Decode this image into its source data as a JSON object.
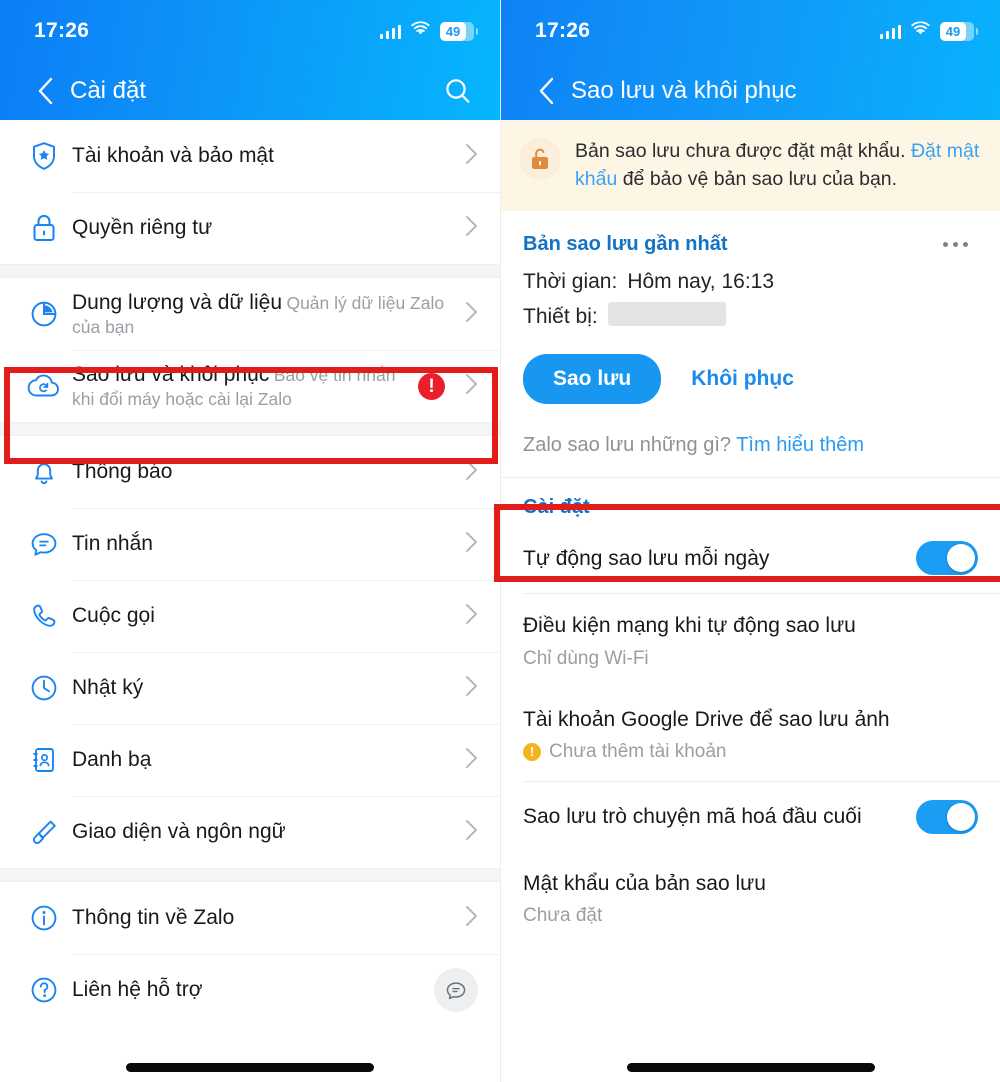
{
  "status_bar": {
    "time": "17:26",
    "battery": "49",
    "signal_icon": "cellular-signal-icon",
    "wifi_icon": "wifi-icon",
    "battery_icon": "battery-icon"
  },
  "left_panel": {
    "nav": {
      "back_icon": "chevron-left-icon",
      "title": "Cài đặt",
      "search_icon": "search-icon"
    },
    "groups": [
      {
        "items": [
          {
            "icon": "shield-star-icon",
            "title": "Tài khoản và bảo mật",
            "sub": "",
            "chevron": "chevron-right-icon"
          },
          {
            "icon": "lock-icon",
            "title": "Quyền riêng tư",
            "sub": "",
            "chevron": "chevron-right-icon"
          }
        ]
      },
      {
        "items": [
          {
            "icon": "pie-chart-icon",
            "title": "Dung lượng và dữ liệu",
            "sub": "Quản lý dữ liệu Zalo của bạn",
            "chevron": "chevron-right-icon"
          },
          {
            "icon": "cloud-backup-icon",
            "title": "Sao lưu và khôi phục",
            "sub": "Bảo vệ tin nhắn khi đổi máy hoặc cài lại Zalo",
            "alert": "!",
            "chevron": "chevron-right-icon"
          }
        ]
      },
      {
        "items": [
          {
            "icon": "bell-icon",
            "title": "Thông báo",
            "sub": "",
            "chevron": "chevron-right-icon"
          },
          {
            "icon": "message-icon",
            "title": "Tin nhắn",
            "sub": "",
            "chevron": "chevron-right-icon"
          },
          {
            "icon": "phone-icon",
            "title": "Cuộc gọi",
            "sub": "",
            "chevron": "chevron-right-icon"
          },
          {
            "icon": "clock-icon",
            "title": "Nhật ký",
            "sub": "",
            "chevron": "chevron-right-icon"
          },
          {
            "icon": "contacts-book-icon",
            "title": "Danh bạ",
            "sub": "",
            "chevron": "chevron-right-icon"
          },
          {
            "icon": "paint-brush-icon",
            "title": "Giao diện và ngôn ngữ",
            "sub": "",
            "chevron": "chevron-right-icon"
          }
        ]
      },
      {
        "items": [
          {
            "icon": "info-circle-icon",
            "title": "Thông tin về Zalo",
            "sub": "",
            "chevron": "chevron-right-icon"
          },
          {
            "icon": "question-circle-icon",
            "title": "Liên hệ hỗ trợ",
            "sub": "",
            "fab": "chat-bubble-icon"
          }
        ]
      }
    ]
  },
  "right_panel": {
    "nav": {
      "back_icon": "chevron-left-icon",
      "title": "Sao lưu và khôi phục"
    },
    "banner": {
      "icon": "unlock-icon",
      "text_before": "Bản sao lưu chưa được đặt mật khẩu. ",
      "link": "Đặt mật khẩu",
      "text_after": " để bảo vệ bản sao lưu của bạn."
    },
    "latest_backup": {
      "section_title": "Bản sao lưu gần nhất",
      "more_icon": "more-horizontal-icon",
      "time_label": "Thời gian:",
      "time_value": "Hôm nay, 16:13",
      "device_label": "Thiết bị:",
      "device_value": ""
    },
    "actions": {
      "backup_button": "Sao lưu",
      "restore_link": "Khôi phục"
    },
    "hint": {
      "text": "Zalo sao lưu những gì? ",
      "link": "Tìm hiểu thêm"
    },
    "settings": {
      "group_title": "Cài đặt",
      "options": [
        {
          "name": "Tự động sao lưu mỗi ngày",
          "value": "",
          "control": "toggle",
          "toggle_on": true
        },
        {
          "name": "Điều kiện mạng khi tự động sao lưu",
          "value": "Chỉ dùng Wi-Fi",
          "control": "none"
        },
        {
          "name": "Tài khoản Google Drive để sao lưu ảnh",
          "value": "Chưa thêm tài khoản",
          "control": "none",
          "warn": "!"
        },
        {
          "name": "Sao lưu trò chuyện mã hoá đầu cuối",
          "value": "",
          "control": "toggle",
          "toggle_on": true
        },
        {
          "name": "Mật khẩu của bản sao lưu",
          "value": "Chưa đặt",
          "control": "none"
        }
      ]
    }
  },
  "annotations": {
    "highlight_color": "#e21b1b",
    "boxes": [
      {
        "target": "sao-luu-va-khoi-phuc-row"
      },
      {
        "target": "tu-dong-sao-luu-moi-ngay-row"
      }
    ]
  },
  "colors": {
    "accent_blue": "#1797f0",
    "header_blue": "#0d8cf7",
    "alert_red": "#eb1f2b",
    "warn_yellow": "#f5b521",
    "banner_bg": "#fdf6e5"
  }
}
